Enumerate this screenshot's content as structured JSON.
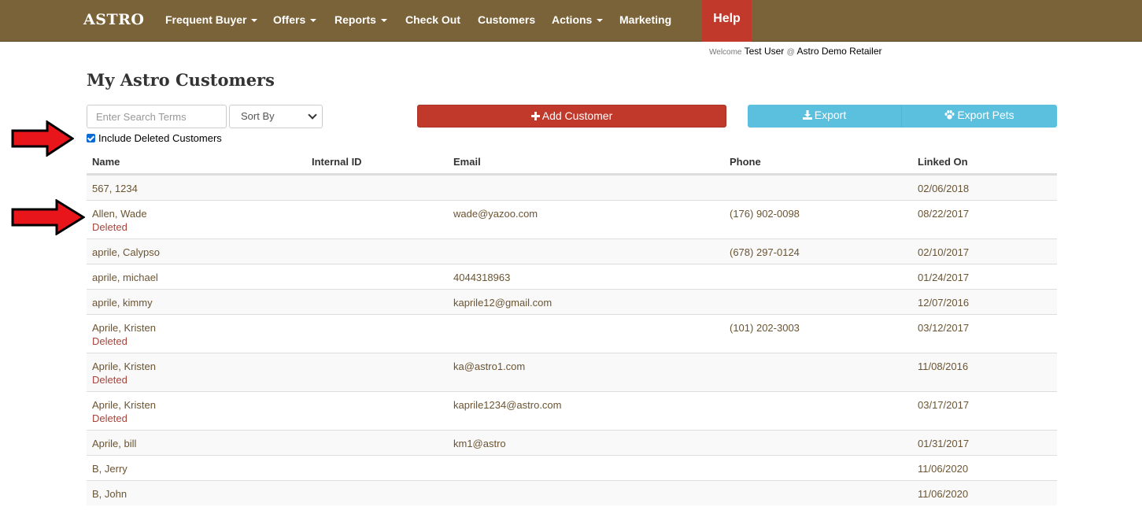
{
  "brand": "ASTRO",
  "nav": {
    "items": [
      {
        "label": "Frequent Buyer",
        "dropdown": true
      },
      {
        "label": "Offers",
        "dropdown": true
      },
      {
        "label": "Reports",
        "dropdown": true
      },
      {
        "label": "Check Out",
        "dropdown": false
      },
      {
        "label": "Customers",
        "dropdown": false
      },
      {
        "label": "Actions",
        "dropdown": true
      },
      {
        "label": "Marketing",
        "dropdown": false
      }
    ],
    "help": "Help"
  },
  "welcome": {
    "prefix": "Welcome",
    "user": "Test User",
    "at": "@",
    "retailer": "Astro Demo Retailer"
  },
  "page_title": "My Astro Customers",
  "controls": {
    "search_placeholder": "Enter Search Terms",
    "sort_label": "Sort By",
    "add_label": "Add Customer",
    "export_label": "Export",
    "export_pets_label": "Export Pets",
    "include_deleted_label": "Include Deleted Customers",
    "include_deleted_checked": true
  },
  "table": {
    "headers": {
      "name": "Name",
      "internal_id": "Internal ID",
      "email": "Email",
      "phone": "Phone",
      "linked_on": "Linked On"
    },
    "rows": [
      {
        "name": "567, 1234",
        "deleted": "",
        "internal_id": "",
        "email": "",
        "phone": "",
        "linked_on": "02/06/2018"
      },
      {
        "name": "Allen, Wade",
        "deleted": "Deleted",
        "internal_id": "",
        "email": "wade@yazoo.com",
        "phone": "(176) 902-0098",
        "linked_on": "08/22/2017"
      },
      {
        "name": "aprile, Calypso",
        "deleted": "",
        "internal_id": "",
        "email": "",
        "phone": "(678) 297-0124",
        "linked_on": "02/10/2017"
      },
      {
        "name": "aprile, michael",
        "deleted": "",
        "internal_id": "",
        "email": "4044318963",
        "phone": "",
        "linked_on": "01/24/2017"
      },
      {
        "name": "aprile, kimmy",
        "deleted": "",
        "internal_id": "",
        "email": "kaprile12@gmail.com",
        "phone": "",
        "linked_on": "12/07/2016"
      },
      {
        "name": "Aprile, Kristen",
        "deleted": "Deleted",
        "internal_id": "",
        "email": "",
        "phone": "(101) 202-3003",
        "linked_on": "03/12/2017"
      },
      {
        "name": "Aprile, Kristen",
        "deleted": "Deleted",
        "internal_id": "",
        "email": "ka@astro1.com",
        "phone": "",
        "linked_on": "11/08/2016"
      },
      {
        "name": "Aprile, Kristen",
        "deleted": "Deleted",
        "internal_id": "",
        "email": "kaprile1234@astro.com",
        "phone": "",
        "linked_on": "03/17/2017"
      },
      {
        "name": "Aprile, bill",
        "deleted": "",
        "internal_id": "",
        "email": "km1@astro",
        "phone": "",
        "linked_on": "01/31/2017"
      },
      {
        "name": "B, Jerry",
        "deleted": "",
        "internal_id": "",
        "email": "",
        "phone": "",
        "linked_on": "11/06/2020"
      },
      {
        "name": "B, John",
        "deleted": "",
        "internal_id": "",
        "email": "",
        "phone": "",
        "linked_on": "11/06/2020"
      }
    ]
  },
  "colors": {
    "nav_bg": "#7b6339",
    "help_bg": "#c0392b",
    "add_bg": "#c0392b",
    "export_bg": "#5bc0de",
    "link_text": "#6b5432",
    "deleted_text": "#a8443a",
    "arrow": "#e8151b"
  }
}
